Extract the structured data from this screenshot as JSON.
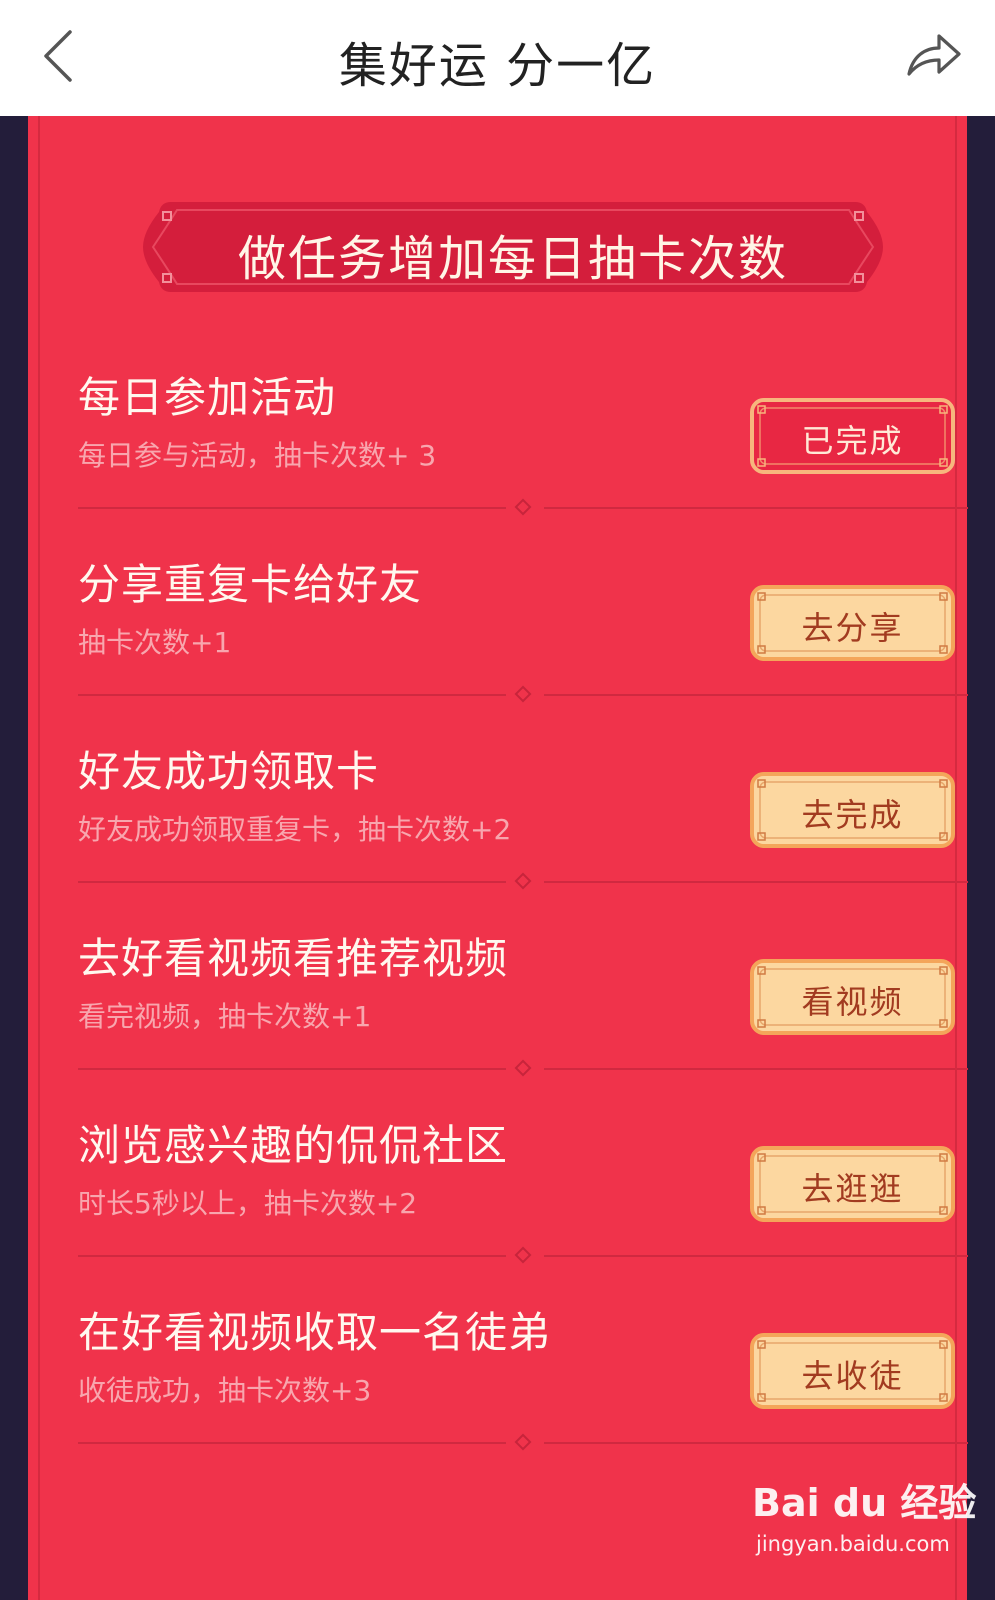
{
  "header": {
    "title": "集好运 分一亿",
    "back_icon": "chevron-left-icon",
    "share_icon": "share-arrow-icon"
  },
  "banner": {
    "text": "做任务增加每日抽卡次数"
  },
  "colors": {
    "panel": "#f0334b",
    "side": "#231d3a",
    "button_gold": "#fcd7a0",
    "button_done": "#ec2c45"
  },
  "tasks": [
    {
      "title": "每日参加活动",
      "desc": "每日参与活动，抽卡次数+ 3",
      "button": "已完成",
      "completed": true
    },
    {
      "title": "分享重复卡给好友",
      "desc": "抽卡次数+1",
      "button": "去分享",
      "completed": false
    },
    {
      "title": "好友成功领取卡",
      "desc": "好友成功领取重复卡，抽卡次数+2",
      "button": "去完成",
      "completed": false
    },
    {
      "title": "去好看视频看推荐视频",
      "desc": "看完视频，抽卡次数+1",
      "button": "看视频",
      "completed": false
    },
    {
      "title": "浏览感兴趣的侃侃社区",
      "desc": "时长5秒以上，抽卡次数+2",
      "button": "去逛逛",
      "completed": false
    },
    {
      "title": "在好看视频收取一名徒弟",
      "desc": "收徒成功，抽卡次数+3",
      "button": "去收徒",
      "completed": false
    }
  ],
  "watermark": {
    "logo": "Bai du 经验",
    "url": "jingyan.baidu.com"
  }
}
